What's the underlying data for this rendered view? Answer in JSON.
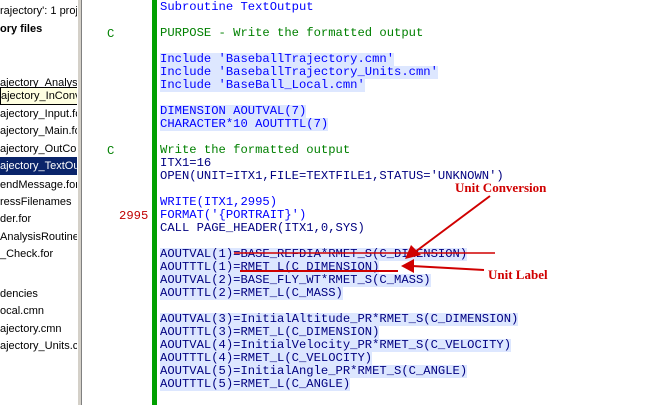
{
  "tree": {
    "items": [
      {
        "label": "rajectory': 1 proje",
        "style": "normal"
      },
      {
        "label": "ory files",
        "style": "bold"
      },
      {
        "label": "",
        "style": "normal"
      },
      {
        "label": "ajectory_Analysi:",
        "style": "normal"
      },
      {
        "label": "ajectory_InConvert.for",
        "style": "boxed"
      },
      {
        "label": "ajectory_Input.fc",
        "style": "normal"
      },
      {
        "label": "ajectory_Main.fo",
        "style": "normal"
      },
      {
        "label": "ajectory_OutCor",
        "style": "normal"
      },
      {
        "label": "ajectory_TextOu",
        "style": "selected"
      },
      {
        "label": "endMessage.for",
        "style": "normal"
      },
      {
        "label": "ressFilenames",
        "style": "normal"
      },
      {
        "label": "der.for",
        "style": "normal"
      },
      {
        "label": "AnalysisRoutine:",
        "style": "normal"
      },
      {
        "label": "_Check.for",
        "style": "normal"
      },
      {
        "label": "",
        "style": "normal"
      },
      {
        "label": "",
        "style": "normal"
      },
      {
        "label": "dencies",
        "style": "normal"
      },
      {
        "label": "ocal.cmn",
        "style": "normal"
      },
      {
        "label": "ajectory.cmn",
        "style": "normal"
      },
      {
        "label": "ajectory_Units.cr",
        "style": "normal"
      }
    ]
  },
  "editor": {
    "lines": [
      {
        "gutter": "",
        "text": "Subroutine TextOutput",
        "type": "kw"
      },
      {
        "gutter": "",
        "text": "",
        "type": "blk"
      },
      {
        "gutter": "C",
        "text": "PURPOSE - Write the formatted output",
        "type": "cmt"
      },
      {
        "gutter": "",
        "text": "",
        "type": "blk"
      },
      {
        "gutter": "",
        "text": "Include 'BaseballTrajectory.cmn'",
        "type": "inc"
      },
      {
        "gutter": "",
        "text": "Include 'BaseballTrajectory_Units.cmn'",
        "type": "inc"
      },
      {
        "gutter": "",
        "text": "Include 'BaseBall_Local.cmn'",
        "type": "inc"
      },
      {
        "gutter": "",
        "text": "",
        "type": "blk"
      },
      {
        "gutter": "",
        "text": "DIMENSION AOUTVAL(7)",
        "type": "kw"
      },
      {
        "gutter": "",
        "text": "CHARACTER*10 AOUTTTL(7)",
        "type": "kw"
      },
      {
        "gutter": "",
        "text": "",
        "type": "blk"
      },
      {
        "gutter": "C",
        "text": "Write the formatted output",
        "type": "cmt"
      },
      {
        "gutter": "",
        "text": "ITX1=16",
        "type": "txt"
      },
      {
        "gutter": "",
        "text": "OPEN(UNIT=ITX1,FILE=TEXTFILE1,STATUS='UNKNOWN')",
        "type": "txt"
      },
      {
        "gutter": "",
        "text": "",
        "type": "blk"
      },
      {
        "gutter": "",
        "text": "WRITE(ITX1,2995)",
        "type": "kw"
      },
      {
        "gutter": "2995",
        "text": "FORMAT('{PORTRAIT}')",
        "type": "kw"
      },
      {
        "gutter": "",
        "text": "CALL PAGE_HEADER(ITX1,0,SYS)",
        "type": "txt"
      },
      {
        "gutter": "",
        "text": "",
        "type": "blk"
      },
      {
        "gutter": "",
        "text": "AOUTVAL(1)=BASE_REFDIA*RMET_S(C_DIMENSION)",
        "type": "txt"
      },
      {
        "gutter": "",
        "text": "AOUTTTL(1)=RMET_L(C_DIMENSION)",
        "type": "txt"
      },
      {
        "gutter": "",
        "text": "AOUTVAL(2)=BASE_FLY_WT*RMET_S(C_MASS)",
        "type": "txt"
      },
      {
        "gutter": "",
        "text": "AOUTTTL(2)=RMET_L(C_MASS)",
        "type": "txt"
      },
      {
        "gutter": "",
        "text": "",
        "type": "blk"
      },
      {
        "gutter": "",
        "text": "AOUTVAL(3)=InitialAltitude_PR*RMET_S(C_DIMENSION)",
        "type": "txt"
      },
      {
        "gutter": "",
        "text": "AOUTTTL(3)=RMET_L(C_DIMENSION)",
        "type": "txt"
      },
      {
        "gutter": "",
        "text": "AOUTVAL(4)=InitialVelocity_PR*RMET_S(C_VELOCITY)",
        "type": "txt"
      },
      {
        "gutter": "",
        "text": "AOUTTTL(4)=RMET_L(C_VELOCITY)",
        "type": "txt"
      },
      {
        "gutter": "",
        "text": "AOUTVAL(5)=InitialAngle_PR*RMET_S(C_ANGLE)",
        "type": "txt"
      },
      {
        "gutter": "",
        "text": "AOUTTTL(5)=RMET_L(C_ANGLE)",
        "type": "txt"
      }
    ]
  },
  "annotations": {
    "unit_conversion": "Unit Conversion",
    "unit_label": "Unit Label",
    "color": "#d00000"
  },
  "colors": {
    "keyword": "#0000ff",
    "comment": "#008000",
    "code": "#000080",
    "scope_bar": "#00a000",
    "selection": "#0a246a"
  }
}
